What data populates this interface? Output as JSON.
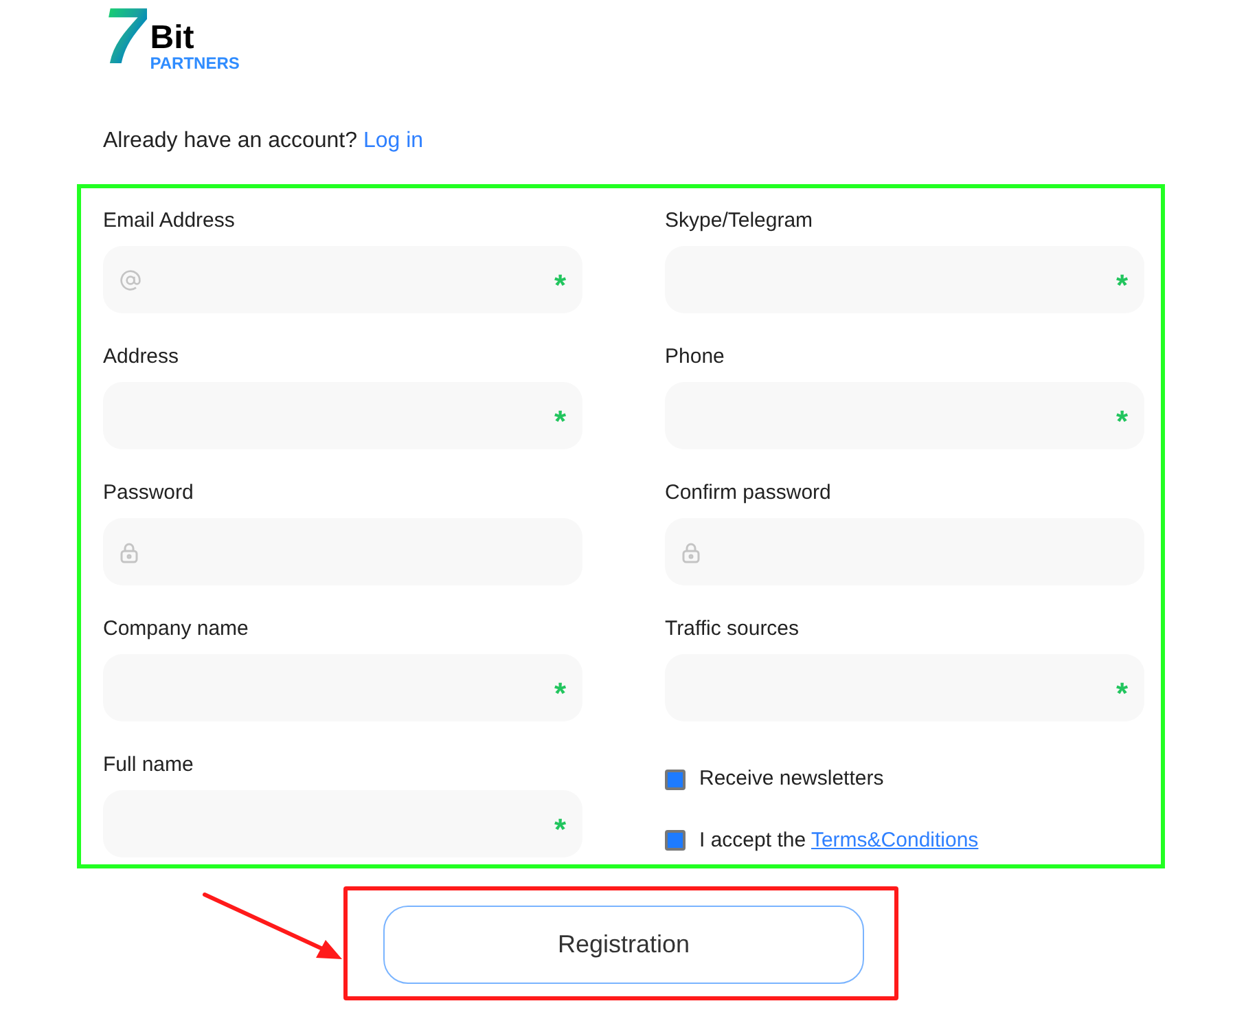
{
  "logo": {
    "mark": "7",
    "word": "Bit",
    "sub": "PARTNERS"
  },
  "login_prompt": {
    "text": "Already have an account?",
    "link": "Log in"
  },
  "fields": [
    {
      "label": "Email Address",
      "kind": "email",
      "required": true
    },
    {
      "label": "Skype/Telegram",
      "kind": "text",
      "required": true
    },
    {
      "label": "Address",
      "kind": "text",
      "required": true
    },
    {
      "label": "Phone",
      "kind": "text",
      "required": true
    },
    {
      "label": "Password",
      "kind": "password",
      "required": false
    },
    {
      "label": "Confirm password",
      "kind": "password",
      "required": false
    },
    {
      "label": "Company name",
      "kind": "text",
      "required": true
    },
    {
      "label": "Traffic sources",
      "kind": "text",
      "required": true
    },
    {
      "label": "Full name",
      "kind": "text",
      "required": true
    }
  ],
  "required_mark": "*",
  "checkboxes": [
    {
      "label": "Receive newsletters",
      "checked": true
    },
    {
      "label": "I accept the",
      "link": "Terms&Conditions",
      "checked": true
    }
  ],
  "submit": "Registration"
}
